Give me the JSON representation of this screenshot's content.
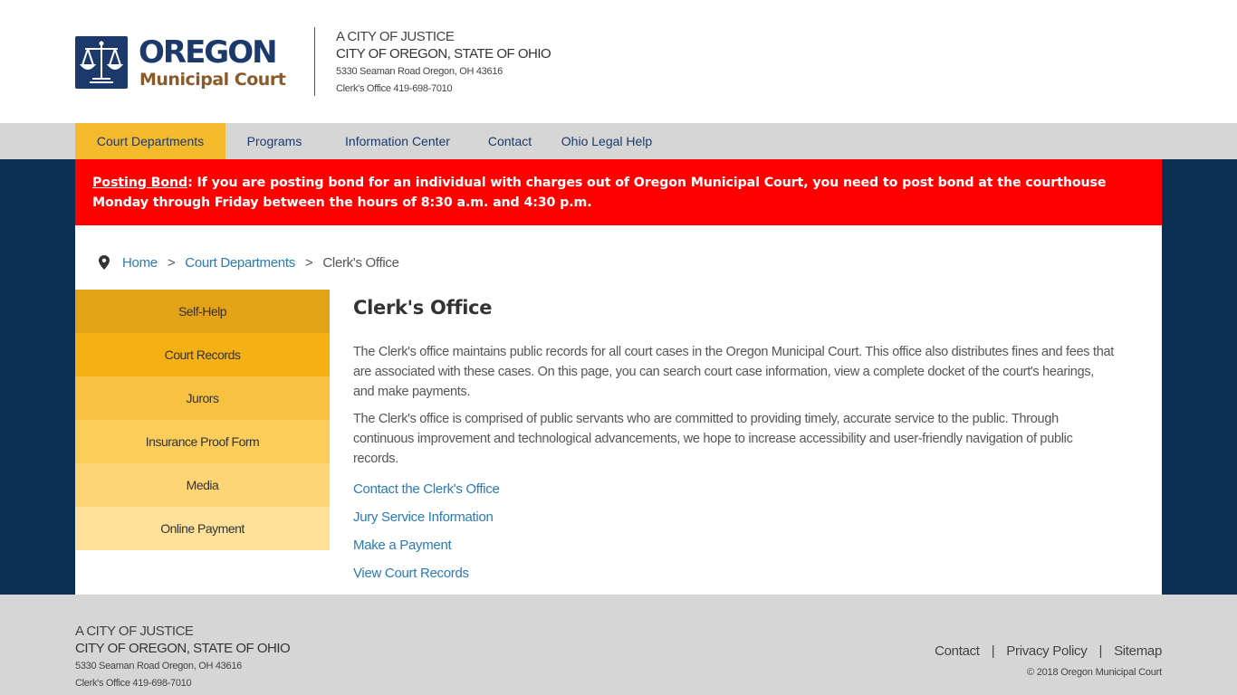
{
  "header": {
    "logo_title": "OREGON",
    "logo_subtitle": "Municipal Court",
    "logo_icon": "scales-of-justice-icon",
    "tagline": "A CITY OF JUSTICE",
    "city": "CITY OF OREGON, STATE OF OHIO",
    "address": "5330 Seaman Road Oregon, OH 43616",
    "phone": "Clerk's Office 419-698-7010"
  },
  "nav": {
    "items": [
      {
        "label": "Court Departments",
        "active": true
      },
      {
        "label": "Programs",
        "active": false
      },
      {
        "label": "Information Center",
        "active": false
      },
      {
        "label": "Contact",
        "active": false
      },
      {
        "label": "Ohio Legal Help",
        "active": false
      }
    ]
  },
  "alert": {
    "label": "Posting Bond",
    "text": "If you are posting bond for an individual with charges out of Oregon Municipal Court, you need to post bond at the courthouse Monday through Friday between the hours of 8:30 a.m. and 4:30 p.m."
  },
  "breadcrumb": {
    "icon": "map-pin-icon",
    "items": [
      "Home",
      "Court Departments",
      "Clerk's Office"
    ],
    "separator": ">"
  },
  "sidebar": {
    "items": [
      {
        "label": "Self-Help",
        "color": "#e4a316"
      },
      {
        "label": "Court Records",
        "color": "#f5b014"
      },
      {
        "label": "Jurors",
        "color": "#f8c240"
      },
      {
        "label": "Insurance Proof Form",
        "color": "#fbcd5a"
      },
      {
        "label": "Media",
        "color": "#fdd575"
      },
      {
        "label": "Online Payment",
        "color": "#ffe199"
      }
    ]
  },
  "main": {
    "title": "Clerk's Office",
    "p1": "The Clerk's office maintains public records for all court cases in the Oregon Municipal Court. This office also distributes fines and fees that are associated with these cases. On this page, you can search court case information, view a complete docket of the court's hearings, and make payments.",
    "p2": "The Clerk's office is comprised of public servants who are committed to providing timely, accurate service to the public. Through continuous improvement and technological advancements, we hope to increase accessibility and user-friendly navigation of public records.",
    "links": [
      "Contact the Clerk's Office",
      "Jury Service Information",
      "Make a Payment",
      "View Court Records"
    ]
  },
  "footer": {
    "tagline": "A CITY OF JUSTICE",
    "city": "CITY OF OREGON, STATE OF OHIO",
    "address": "5330 Seaman Road Oregon, OH 43616",
    "phone": "Clerk's Office 419-698-7010",
    "links": [
      "Contact",
      "Privacy Policy",
      "Sitemap"
    ],
    "separator": "|",
    "copyright": "© 2018 Oregon Municipal Court"
  },
  "colors": {
    "navy": "#0c2f56",
    "brand_blue": "#1b3a6b",
    "brand_brown": "#8a5a2b",
    "alert_red": "#ff0000",
    "nav_active": "#f5b92e",
    "link_blue": "#2a7ab8",
    "gray_band": "#d6d6d6"
  }
}
